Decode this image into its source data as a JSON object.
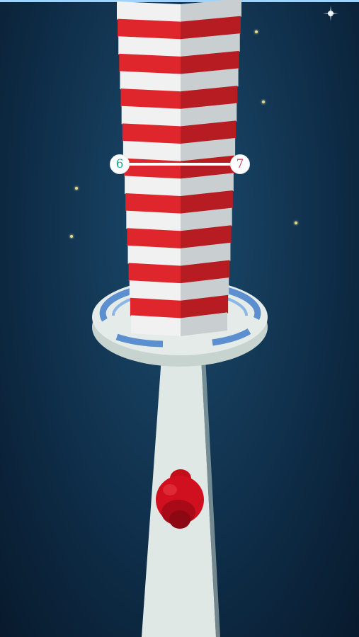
{
  "level": {
    "current": "6",
    "next": "7",
    "current_color": "#19a98f",
    "next_color": "#d9476a"
  },
  "colors": {
    "tower_red": "#e0262d",
    "tower_white": "#f1f1f1",
    "ring_blue": "#5b8fcf",
    "platform": "#dfe8e4",
    "ball": "#d0101e",
    "sky_top": "#1b4c6e",
    "sky_bottom": "#081a2c"
  },
  "tower": {
    "stack_pattern": [
      "white",
      "red",
      "white",
      "red",
      "white",
      "red",
      "white",
      "red",
      "white",
      "red",
      "white",
      "red",
      "white",
      "red",
      "white",
      "red",
      "white",
      "red",
      "white"
    ]
  }
}
